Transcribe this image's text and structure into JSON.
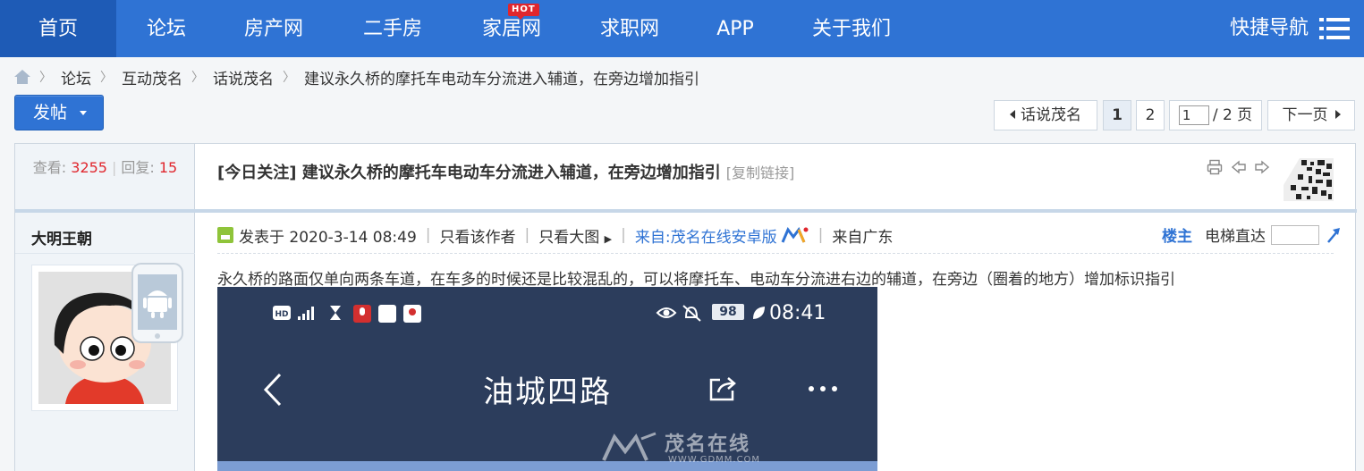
{
  "nav": {
    "items": [
      {
        "label": "首页",
        "active": true
      },
      {
        "label": "论坛"
      },
      {
        "label": "房产网"
      },
      {
        "label": "二手房"
      },
      {
        "label": "家居网",
        "badge": "HOT"
      },
      {
        "label": "求职网"
      },
      {
        "label": "APP"
      },
      {
        "label": "关于我们"
      }
    ],
    "quick_nav": "快捷导航",
    "quick_nav_icon": "list-menu-icon"
  },
  "breadcrumb": {
    "home_icon": "home-icon",
    "items": [
      "论坛",
      "互动茂名",
      "话说茂名",
      "建议永久桥的摩托车电动车分流进入辅道，在旁边增加指引"
    ]
  },
  "toolbar": {
    "post_button": "发帖",
    "back_to_forum": "话说茂名",
    "pages": [
      "1",
      "2"
    ],
    "current_page": "1",
    "page_input_value": "1",
    "page_total": "/ 2 页",
    "next_page": "下一页"
  },
  "thread": {
    "stats": {
      "views_label": "查看:",
      "views": "3255",
      "replies_label": "回复:",
      "replies": "15"
    },
    "title": "[今日关注] 建议永久桥的摩托车电动车分流进入辅道，在旁边增加指引",
    "copy_link": "[复制链接]",
    "tool_icons": [
      "print-icon",
      "prev-thread-icon",
      "next-thread-icon",
      "qr-code-icon"
    ]
  },
  "post": {
    "author": "大明王朝",
    "posted_at": "发表于 2020-3-14 08:49",
    "only_author": "只看该作者",
    "only_large_image": "只看大图",
    "source": "来自:茂名在线安卓版",
    "location": "来自广东",
    "floor_label": "楼主",
    "elevator_label": "电梯直达",
    "content": "永久桥的路面仅单向两条车道，在车多的时候还是比较混乱的，可以将摩托车、电动车分流进右边的辅道，在旁边（圈着的地方）增加标识指引",
    "image": {
      "status_time": "08:41",
      "battery": "98",
      "page_title": "油城四路",
      "watermark": "茂名在线",
      "watermark_url": "WWW.GDMM.COM"
    }
  },
  "colors": {
    "nav_bg": "#2f73d4",
    "nav_active": "#1e5bb6",
    "count_red": "#e0262d",
    "link_blue": "#2f73d4"
  }
}
